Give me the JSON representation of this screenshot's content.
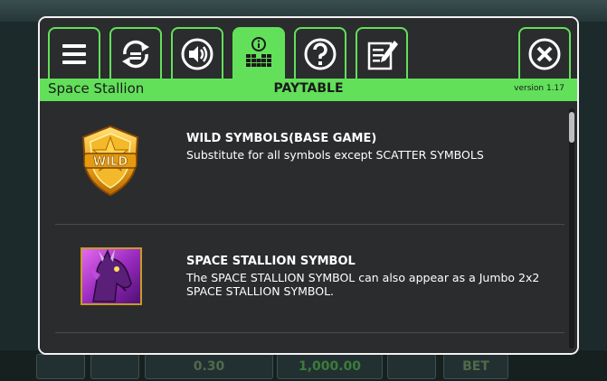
{
  "background": {
    "bet_value": "0.30",
    "balance_value": "1,000.00",
    "bet_label": "BET"
  },
  "tabs": [
    {
      "name": "menu-icon",
      "active": false
    },
    {
      "name": "autoplay-icon",
      "active": false
    },
    {
      "name": "sound-icon",
      "active": false
    },
    {
      "name": "paytable-icon",
      "active": true
    },
    {
      "name": "help-icon",
      "active": false
    },
    {
      "name": "history-icon",
      "active": false
    }
  ],
  "close_icon": "close-icon",
  "header": {
    "game_title": "Space Stallion",
    "page_title": "PAYTABLE",
    "version": "version 1.17"
  },
  "symbols": [
    {
      "icon": "wild-shield-icon",
      "icon_text": "WILD",
      "title": "WILD SYMBOLS(BASE GAME)",
      "description": "Substitute for all symbols except SCATTER SYMBOLS"
    },
    {
      "icon": "space-stallion-icon",
      "title": "SPACE STALLION SYMBOL",
      "description": "The SPACE STALLION SYMBOL can also appear as a Jumbo 2x2 SPACE STALLION SYMBOL."
    }
  ],
  "colors": {
    "accent": "#62e05a",
    "panel": "#2b2c2e",
    "border": "#f2f2f2"
  }
}
